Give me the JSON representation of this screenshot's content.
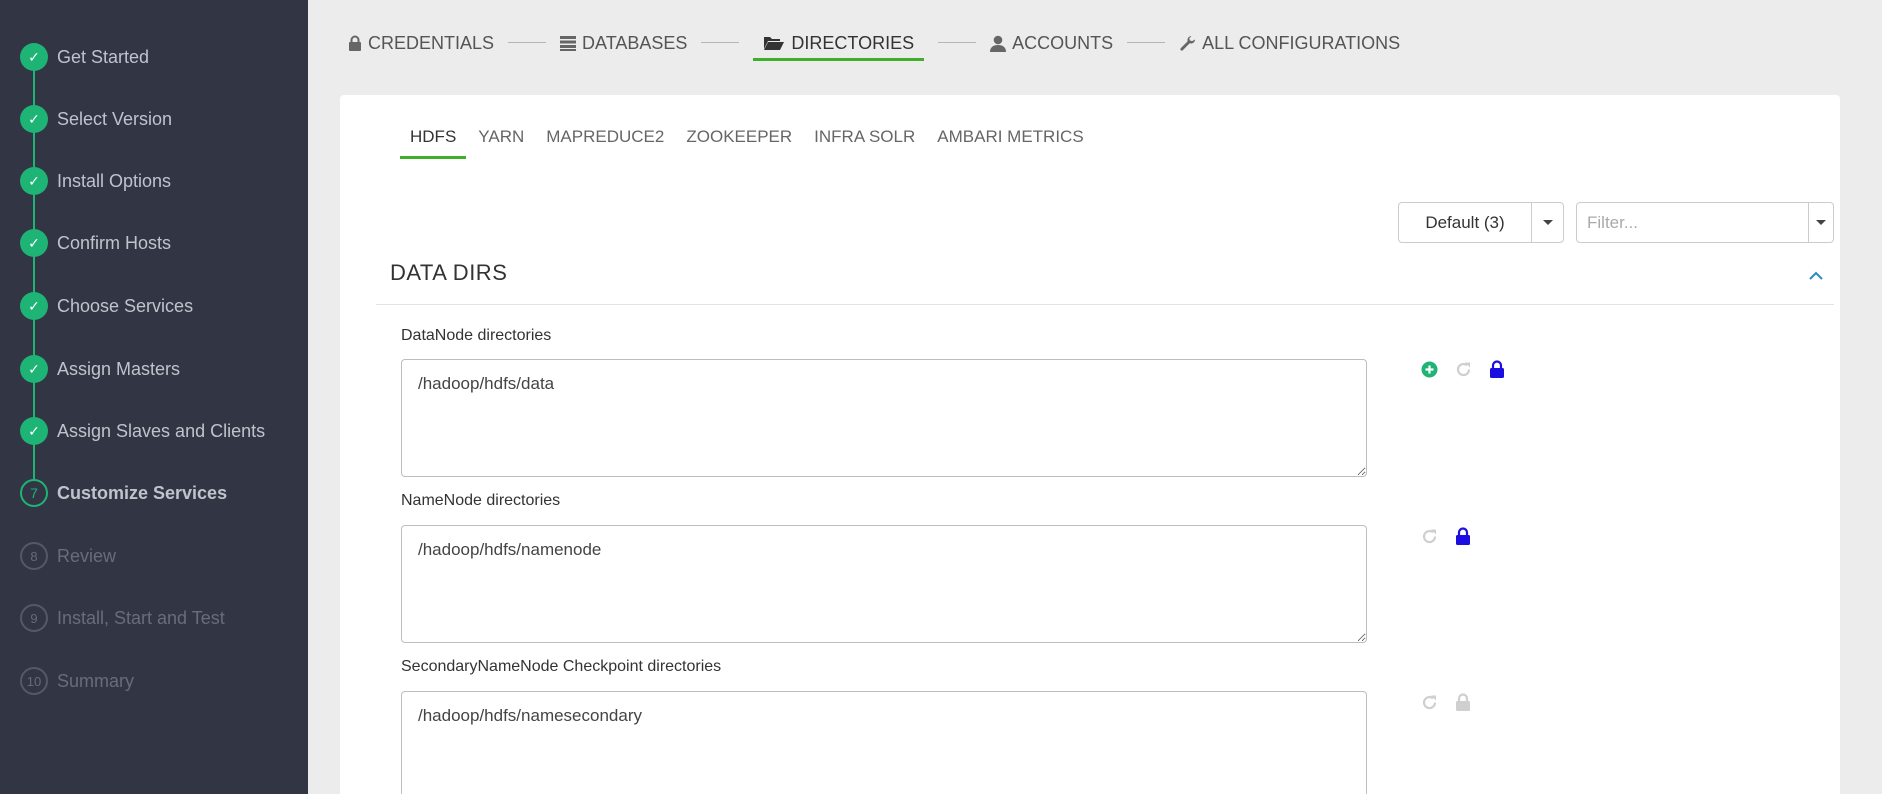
{
  "sidebar": {
    "steps": [
      {
        "label": "Get Started",
        "marker": "✓",
        "state": "done"
      },
      {
        "label": "Select Version",
        "marker": "✓",
        "state": "done"
      },
      {
        "label": "Install Options",
        "marker": "✓",
        "state": "done"
      },
      {
        "label": "Confirm Hosts",
        "marker": "✓",
        "state": "done"
      },
      {
        "label": "Choose Services",
        "marker": "✓",
        "state": "done"
      },
      {
        "label": "Assign Masters",
        "marker": "✓",
        "state": "done"
      },
      {
        "label": "Assign Slaves and Clients",
        "marker": "✓",
        "state": "done"
      },
      {
        "label": "Customize Services",
        "marker": "7",
        "state": "current"
      },
      {
        "label": "Review",
        "marker": "8",
        "state": "todo"
      },
      {
        "label": "Install, Start and Test",
        "marker": "9",
        "state": "todo"
      },
      {
        "label": "Summary",
        "marker": "10",
        "state": "todo"
      }
    ]
  },
  "topnav": {
    "tabs": [
      {
        "label": "CREDENTIALS",
        "icon": "lock-icon"
      },
      {
        "label": "DATABASES",
        "icon": "database-icon"
      },
      {
        "label": "DIRECTORIES",
        "icon": "folder-open-icon",
        "active": true
      },
      {
        "label": "ACCOUNTS",
        "icon": "user-icon"
      },
      {
        "label": "ALL CONFIGURATIONS",
        "icon": "wrench-icon"
      }
    ]
  },
  "subtabs": [
    {
      "label": "HDFS",
      "active": true
    },
    {
      "label": "YARN"
    },
    {
      "label": "MAPREDUCE2"
    },
    {
      "label": "ZOOKEEPER"
    },
    {
      "label": "INFRA SOLR"
    },
    {
      "label": "AMBARI METRICS"
    }
  ],
  "config_group": {
    "label": "Default (3)"
  },
  "filter": {
    "placeholder": "Filter..."
  },
  "section": {
    "title": "DATA DIRS"
  },
  "fields": [
    {
      "label": "DataNode directories",
      "value": "/hadoop/hdfs/data",
      "actions": [
        "plus-circle-icon",
        "undo-icon",
        "lock-icon"
      ]
    },
    {
      "label": "NameNode directories",
      "value": "/hadoop/hdfs/namenode",
      "actions": [
        "undo-icon",
        "lock-icon"
      ]
    },
    {
      "label": "SecondaryNameNode Checkpoint directories",
      "value": "/hadoop/hdfs/namesecondary",
      "actions": [
        "undo-icon",
        "lock-icon"
      ]
    }
  ],
  "colors": {
    "sidebar_bg": "#323544",
    "accent_green": "#1eb475",
    "tab_underline": "#3fae2a",
    "lock_active": "#1a0fe0",
    "icon_disabled": "#cfcfcf"
  }
}
